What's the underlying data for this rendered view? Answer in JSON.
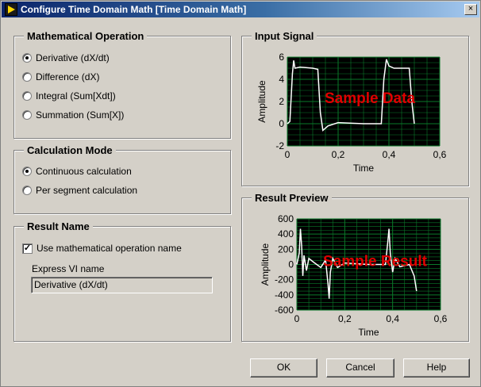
{
  "window": {
    "title": "Configure Time Domain Math [Time Domain Math]",
    "close_glyph": "×"
  },
  "math_op": {
    "title": "Mathematical Operation",
    "options": [
      {
        "label": "Derivative (dX/dt)",
        "selected": true
      },
      {
        "label": "Difference (dX)",
        "selected": false
      },
      {
        "label": "Integral (Sum[Xdt])",
        "selected": false
      },
      {
        "label": "Summation (Sum[X])",
        "selected": false
      }
    ]
  },
  "calc_mode": {
    "title": "Calculation Mode",
    "options": [
      {
        "label": "Continuous calculation",
        "selected": true
      },
      {
        "label": "Per segment calculation",
        "selected": false
      }
    ]
  },
  "result_name": {
    "title": "Result Name",
    "checkbox_label": "Use mathematical operation name",
    "checked": true,
    "field_label": "Express VI name",
    "field_value": "Derivative (dX/dt)"
  },
  "input_signal": {
    "title": "Input Signal",
    "overlay_text": "Sample Data",
    "xlabel": "Time",
    "ylabel": "Amplitude",
    "xticks": [
      "0",
      "0,2",
      "0,4",
      "0,6"
    ],
    "yticks": [
      "6",
      "4",
      "2",
      "0",
      "-2"
    ]
  },
  "result_preview": {
    "title": "Result Preview",
    "overlay_text": "Sample Result",
    "xlabel": "Time",
    "ylabel": "Amplitude",
    "xticks": [
      "0",
      "0,2",
      "0,4",
      "0,6"
    ],
    "yticks": [
      "600",
      "400",
      "200",
      "0",
      "-200",
      "-400",
      "-600"
    ]
  },
  "buttons": {
    "ok": "OK",
    "cancel": "Cancel",
    "help": "Help"
  },
  "colors": {
    "plot_bg": "#000000",
    "grid": "#0a7a2a",
    "trace": "#ffffff",
    "overlay": "#e00000"
  },
  "chart_data": [
    {
      "type": "line",
      "xlabel": "Time",
      "ylabel": "Amplitude",
      "xlim": [
        0,
        0.6
      ],
      "ylim": [
        -2,
        6
      ],
      "series": [
        {
          "x": [
            0,
            0.01,
            0.02,
            0.025,
            0.03,
            0.05,
            0.1,
            0.12,
            0.13,
            0.14,
            0.16,
            0.2,
            0.3,
            0.37,
            0.38,
            0.39,
            0.4,
            0.42,
            0.48,
            0.49,
            0.5
          ],
          "y": [
            0,
            0.2,
            4.5,
            5.7,
            5.0,
            5.1,
            5.0,
            4.9,
            1.0,
            -0.6,
            -0.2,
            0.1,
            0.0,
            0.0,
            4.0,
            5.8,
            5.2,
            5.0,
            5.0,
            2.0,
            0.0
          ]
        }
      ]
    },
    {
      "type": "line",
      "xlabel": "Time",
      "ylabel": "Amplitude",
      "xlim": [
        0,
        0.6
      ],
      "ylim": [
        -600,
        600
      ],
      "series": [
        {
          "x": [
            0,
            0.01,
            0.015,
            0.02,
            0.025,
            0.03,
            0.04,
            0.05,
            0.07,
            0.1,
            0.12,
            0.13,
            0.135,
            0.14,
            0.15,
            0.17,
            0.2,
            0.3,
            0.37,
            0.38,
            0.385,
            0.39,
            0.4,
            0.41,
            0.43,
            0.47,
            0.49,
            0.5
          ],
          "y": [
            0,
            150,
            470,
            250,
            -150,
            120,
            -80,
            80,
            30,
            -40,
            60,
            -250,
            -450,
            -100,
            80,
            -40,
            20,
            0,
            0,
            300,
            470,
            150,
            -100,
            80,
            -30,
            0,
            -150,
            -350
          ]
        }
      ]
    }
  ]
}
